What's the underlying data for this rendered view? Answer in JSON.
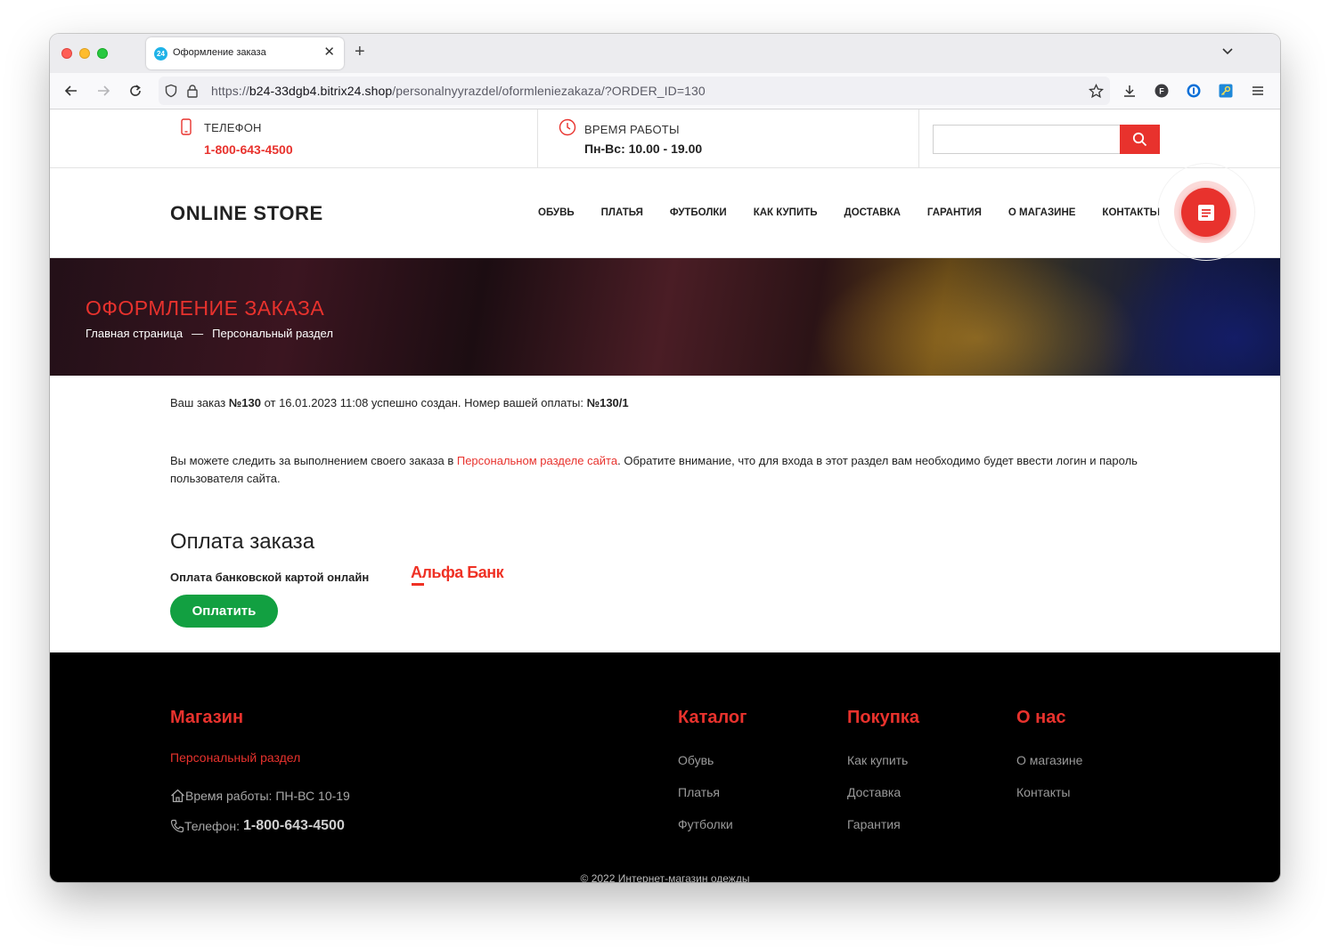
{
  "browser": {
    "tab_title": "Оформление заказа",
    "tab_favicon_text": "24",
    "url_prefix": "https://",
    "url_host": "b24-33dgb4.bitrix24.shop",
    "url_path": "/personalnyyrazdel/oformleniezakaza/?ORDER_ID=130"
  },
  "topbar": {
    "phone_label": "ТЕЛЕФОН",
    "phone_value": "1-800-643-4500",
    "hours_label": "ВРЕМЯ РАБОТЫ",
    "hours_value": "Пн-Вс: 10.00 - 19.00",
    "search_value": ""
  },
  "header": {
    "logo": "ONLINE STORE",
    "menu": [
      "ОБУВЬ",
      "ПЛАТЬЯ",
      "ФУТБОЛКИ",
      "КАК КУПИТЬ",
      "ДОСТАВКА",
      "ГАРАНТИЯ",
      "О МАГАЗИНЕ",
      "КОНТАКТЫ"
    ]
  },
  "banner": {
    "title": "ОФОРМЛЕНИЕ ЗАКАЗА",
    "breadcrumb_home": "Главная страница",
    "breadcrumb_separator": "—",
    "breadcrumb_current": "Персональный раздел"
  },
  "order": {
    "prefix": "Ваш заказ ",
    "number": "№130",
    "middle": " от 16.01.2023 11:08 успешно создан. Номер вашей оплаты: ",
    "payment_number": "№130/1",
    "track_before": "Вы можете следить за выполнением своего заказа в ",
    "track_link": "Персональном разделе сайта",
    "track_after": ". Обратите внимание, что для входа в этот раздел вам необходимо будет ввести логин и пароль пользователя сайта."
  },
  "payment": {
    "title": "Оплата заказа",
    "method": "Оплата банковской картой онлайн",
    "bank_logo": "Альфа Банк",
    "button": "Оплатить"
  },
  "footer": {
    "shop_heading": "Магазин",
    "personal_link": "Персональный раздел",
    "hours_text": "Время работы: ПН-ВС 10-19",
    "phone_label": "Телефон:",
    "phone_value": "1-800-643-4500",
    "catalog_heading": "Каталог",
    "catalog_links": [
      "Обувь",
      "Платья",
      "Футболки"
    ],
    "buy_heading": "Покупка",
    "buy_links": [
      "Как купить",
      "Доставка",
      "Гарантия"
    ],
    "about_heading": "О нас",
    "about_links": [
      "О магазине",
      "Контакты"
    ],
    "copyright": "© 2022 Интернет-магазин одежды"
  },
  "colors": {
    "accent": "#e8322d",
    "pay_button": "#12a041",
    "footer_bg": "#000000"
  }
}
